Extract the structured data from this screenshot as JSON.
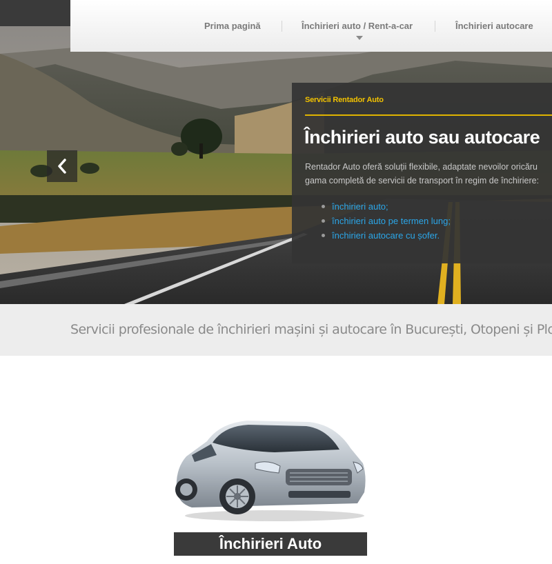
{
  "nav": {
    "items": [
      {
        "label": "Prima pagină"
      },
      {
        "label": "Închirieri auto / Rent-a-car"
      },
      {
        "label": "Închirieri autocare"
      }
    ]
  },
  "hero": {
    "kicker": "Servicii Rentador Auto",
    "title": "Închirieri auto sau autocare",
    "text_line1": "Rentador Auto oferă soluții flexibile, adaptate nevoilor oricăru",
    "text_line2": "gama completă de servicii de transport în regim de închiriere:",
    "links": [
      "închirieri auto;",
      "închirieri auto pe termen lung;",
      "închirieri autocare cu șofer."
    ],
    "prev_icon": "chevron-left-icon"
  },
  "tagline": "Servicii profesionale de închirieri mașini și autocare în București, Otopeni și Ploiești",
  "card": {
    "title": "Închirieri Auto",
    "image": "silver-sedan-car"
  },
  "colors": {
    "accent": "#f2c200",
    "link": "#2ba6e8",
    "overlay": "#343434"
  }
}
